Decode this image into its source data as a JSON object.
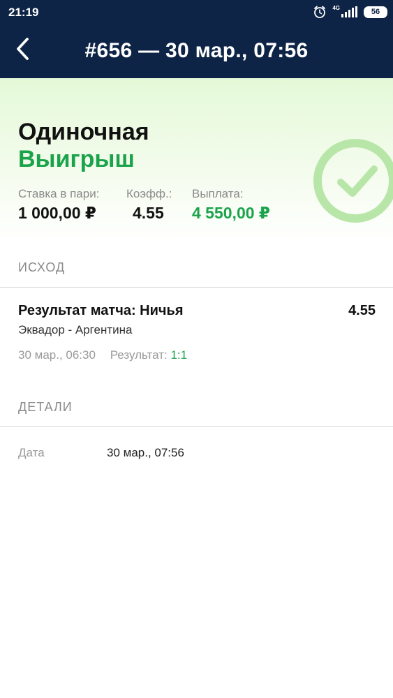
{
  "status_bar": {
    "time": "21:19",
    "network": "4G",
    "battery": "56",
    "icons": [
      "alarm-icon",
      "signal-icon",
      "battery-icon"
    ]
  },
  "header": {
    "title": "#656 — 30 мар., 07:56",
    "back_icon": "chevron-left-icon"
  },
  "summary": {
    "bet_type": "Одиночная",
    "status": "Выигрыш",
    "stake_label": "Ставка в пари:",
    "stake_value": "1 000,00 ₽",
    "odds_label": "Коэфф.:",
    "odds_value": "4.55",
    "payout_label": "Выплата:",
    "payout_value": "4 550,00 ₽",
    "badge_icon": "checkmark-circle-icon"
  },
  "outcome_section": {
    "header": "ИСХОД",
    "title": "Результат матча: Ничья",
    "odds": "4.55",
    "event": "Эквадор - Аргентина",
    "date": "30 мар., 06:30",
    "result_label": "Результат:",
    "result_value": "1:1"
  },
  "details_section": {
    "header": "ДЕТАЛИ",
    "date_label": "Дата",
    "date_value": "30 мар., 07:56"
  },
  "colors": {
    "header_bg": "#0e2446",
    "win_green": "#1aa34a",
    "badge_green": "#b8e6a8",
    "muted_text": "#8a8a8a"
  }
}
